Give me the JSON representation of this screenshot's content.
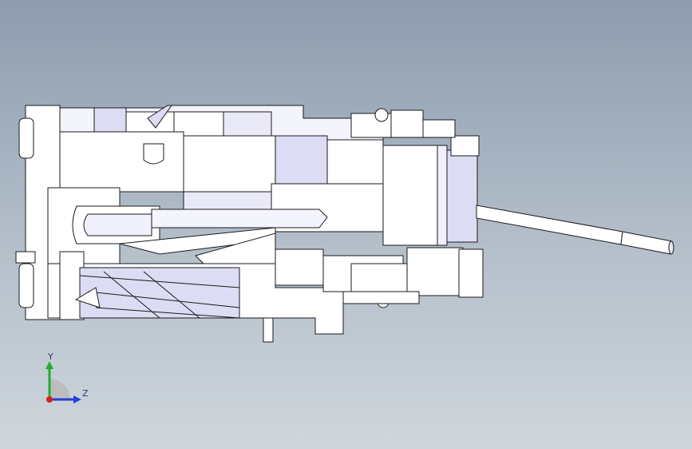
{
  "viewport": {
    "background_top": "#8d9cae",
    "background_bottom": "#cfd6dc"
  },
  "model": {
    "face_color": "#ffffff",
    "shade_color": "#dcdcf4",
    "dark_shade_color": "#b9b9e6",
    "edge_color": "#1a1a1a"
  },
  "triad": {
    "y_label": "Y",
    "z_label": "Z",
    "y_color": "#1fae32",
    "z_color": "#2340d8",
    "x_color": "#d21f1f"
  }
}
